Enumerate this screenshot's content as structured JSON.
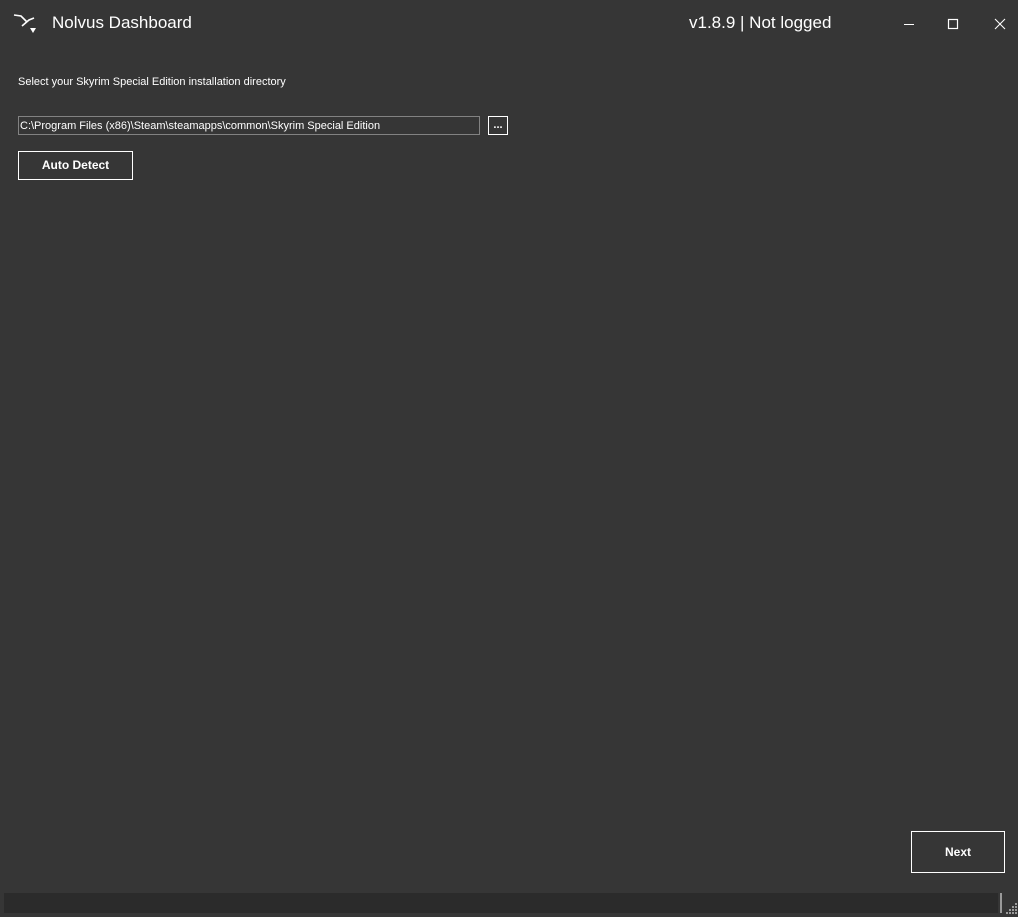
{
  "window": {
    "title": "Nolvus Dashboard",
    "version_status": "v1.8.9 | Not logged",
    "icons": {
      "app": "nolvus-logo-icon",
      "minimize": "minimize-icon",
      "maximize": "maximize-icon",
      "close": "close-icon",
      "resize": "resize-grip-icon"
    }
  },
  "form": {
    "instruction": "Select your Skyrim Special Edition installation directory",
    "install_path_value": "C:\\Program Files (x86)\\Steam\\steamapps\\common\\Skyrim Special Edition",
    "browse_label": "...",
    "auto_detect_label": "Auto Detect"
  },
  "footer": {
    "next_label": "Next"
  },
  "colors": {
    "background": "#363636",
    "text": "#ffffff",
    "input_border": "#828282",
    "status_strip": "#2b2b2b"
  }
}
